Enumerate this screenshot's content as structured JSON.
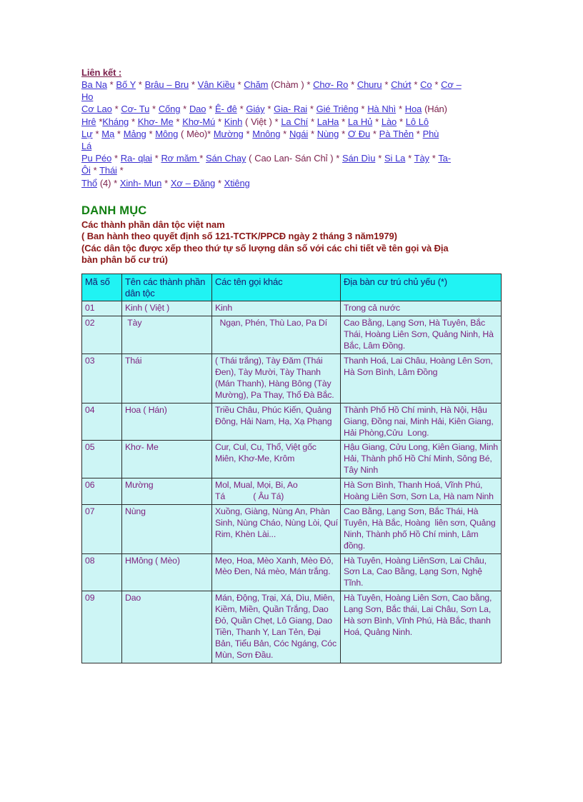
{
  "links": {
    "title": "Liên kết :",
    "lines": [
      [
        {
          "t": "Ba Na",
          "link": true
        },
        {
          "t": " * ",
          "link": false
        },
        {
          "t": "Bố Y",
          "link": true
        },
        {
          "t": " * ",
          "link": false
        },
        {
          "t": "Brâu – Bru",
          "link": true
        },
        {
          "t": " * ",
          "link": false
        },
        {
          "t": "Vân Kiều",
          "link": true
        },
        {
          "t": " * ",
          "link": false
        },
        {
          "t": "Chăm",
          "link": true
        },
        {
          "t": " (Chàm ) * ",
          "link": false
        },
        {
          "t": "Chơ- Ro",
          "link": true
        },
        {
          "t": " * ",
          "link": false
        },
        {
          "t": "Churu",
          "link": true
        },
        {
          "t": " * ",
          "link": false
        },
        {
          "t": "Chứt",
          "link": true
        },
        {
          "t": " *  ",
          "link": false
        },
        {
          "t": "Co",
          "link": true
        },
        {
          "t": " * ",
          "link": false
        },
        {
          "t": "Cơ –",
          "link": true
        }
      ],
      [
        {
          "t": "Ho",
          "link": true
        }
      ],
      [
        {
          "t": "Cơ Lao",
          "link": true
        },
        {
          "t": " * ",
          "link": false
        },
        {
          "t": "Cơ- Tu",
          "link": true
        },
        {
          "t": " * ",
          "link": false
        },
        {
          "t": "Cống",
          "link": true
        },
        {
          "t": " * ",
          "link": false
        },
        {
          "t": "Dao",
          "link": true
        },
        {
          "t": " * ",
          "link": false
        },
        {
          "t": "Ê- đê",
          "link": true
        },
        {
          "t": " *  ",
          "link": false
        },
        {
          "t": "Giáy",
          "link": true
        },
        {
          "t": " * ",
          "link": false
        },
        {
          "t": "Gia- Rai",
          "link": true
        },
        {
          "t": " * ",
          "link": false
        },
        {
          "t": "Gié Triêng",
          "link": true
        },
        {
          "t": " * ",
          "link": false
        },
        {
          "t": "Hà Nhì",
          "link": true
        },
        {
          "t": " * ",
          "link": false
        },
        {
          "t": "Hoa",
          "link": true
        },
        {
          "t": " (Hán)",
          "link": false
        }
      ],
      [
        {
          "t": "Hrê",
          "link": true
        },
        {
          "t": " *",
          "link": false
        },
        {
          "t": "Kháng",
          "link": true
        },
        {
          "t": " * ",
          "link": false
        },
        {
          "t": "Khơ- Me",
          "link": true
        },
        {
          "t": " * ",
          "link": false
        },
        {
          "t": "Khơ-Mú",
          "link": true
        },
        {
          "t": " * ",
          "link": false
        },
        {
          "t": "Kinh",
          "link": true
        },
        {
          "t": " ( Việt ) * ",
          "link": false
        },
        {
          "t": "La Chí",
          "link": true
        },
        {
          "t": " * ",
          "link": false
        },
        {
          "t": "LaHa",
          "link": true
        },
        {
          "t": " * ",
          "link": false
        },
        {
          "t": "La Hủ",
          "link": true
        },
        {
          "t": " * ",
          "link": false
        },
        {
          "t": "Lào",
          "link": true
        },
        {
          "t": " * ",
          "link": false
        },
        {
          "t": "Lô Lô",
          "link": true
        }
      ],
      [
        {
          "t": "Lự",
          "link": true
        },
        {
          "t": " * ",
          "link": false
        },
        {
          "t": "Mạ",
          "link": true
        },
        {
          "t": "  * ",
          "link": false
        },
        {
          "t": "Mảng",
          "link": true
        },
        {
          "t": " * ",
          "link": false
        },
        {
          "t": "Mông",
          "link": true
        },
        {
          "t": " ( Mèo)* ",
          "link": false
        },
        {
          "t": "Mường",
          "link": true
        },
        {
          "t": "  * ",
          "link": false
        },
        {
          "t": "Mnông",
          "link": true
        },
        {
          "t": " * ",
          "link": false
        },
        {
          "t": " Ngái",
          "link": true
        },
        {
          "t": " * ",
          "link": false
        },
        {
          "t": "Nùng",
          "link": true
        },
        {
          "t": "  * ",
          "link": false
        },
        {
          "t": "Ơ Đu",
          "link": true
        },
        {
          "t": " * ",
          "link": false
        },
        {
          "t": "Pà Thẻn",
          "link": true
        },
        {
          "t": " * ",
          "link": false
        },
        {
          "t": "Phù",
          "link": true
        }
      ],
      [
        {
          "t": "Lá",
          "link": true
        }
      ],
      [
        {
          "t": "Pu Péo",
          "link": true
        },
        {
          "t": " * ",
          "link": false
        },
        {
          "t": "Ra- qlai",
          "link": true
        },
        {
          "t": " *   ",
          "link": false
        },
        {
          "t": "Rơ măm ",
          "link": true
        },
        {
          "t": " * ",
          "link": false
        },
        {
          "t": "Sán Chay",
          "link": true
        },
        {
          "t": " ( Cao Lan- Sán Chỉ ) * ",
          "link": false
        },
        {
          "t": "Sán Dìu",
          "link": true
        },
        {
          "t": " * ",
          "link": false
        },
        {
          "t": "Si La",
          "link": true
        },
        {
          "t": " * ",
          "link": false
        },
        {
          "t": "Tày",
          "link": true
        },
        {
          "t": " * ",
          "link": false
        },
        {
          "t": "Ta-",
          "link": true
        }
      ],
      [
        {
          "t": "Ôi",
          "link": true
        },
        {
          "t": " *  ",
          "link": false
        },
        {
          "t": "Thái",
          "link": true
        },
        {
          "t": " *",
          "link": false
        }
      ],
      [
        {
          "t": "Thổ",
          "link": true
        },
        {
          "t": " (4) * ",
          "link": false
        },
        {
          "t": "Xinh- Mun",
          "link": true
        },
        {
          "t": " * ",
          "link": false
        },
        {
          "t": "Xơ – Đăng",
          "link": true
        },
        {
          "t": " * ",
          "link": false
        },
        {
          "t": "Xtiêng",
          "link": true
        }
      ]
    ]
  },
  "heading": {
    "title": "DANH MỤC",
    "subtitle1": "Các thành phần dân tộc việt nam",
    "subtitle2": "( Ban hành theo quyết định số 121-TCTK/PPCĐ   ngày 2 tháng 3 năm1979)",
    "subtitle3": "(Các dân tộc được xếp theo thứ tự số lượng  dân số với các chi tiết về tên gọi và Địa",
    "subtitle4": "bàn phân bố cư trú)"
  },
  "table": {
    "columns": [
      "Mã số",
      "Tên các thành phần dân tộc",
      "Các tên gọi khác",
      "Địa bàn cư trú chủ yếu (*)"
    ],
    "rows": [
      {
        "code": "01",
        "name": "Kinh ( Việt )",
        "other": "Kinh",
        "region": "Trong cả nước"
      },
      {
        "code": "02",
        "name": " Tày",
        "other": "  Ngạn, Phén, Thù Lao, Pa Dí",
        "region": "Cao Bằng, Lạng Sơn, Hà Tuyên, Bắc Thái, Hoàng Liên Sơn, Quảng Ninh, Hà Bắc, Lâm Đồng."
      },
      {
        "code": "03",
        "name": "Thái",
        "other": "( Thái trắng), Tày Đăm (Thái Đen), Tày Mười, Tày Thanh (Mán Thanh), Hàng Bông (Tày Mường), Pa Thay, Thổ Đà Bắc.",
        "region": "Thanh Hoá, Lai Châu, Hoàng Lên Sơn, Hà Sơn Bình, Lâm Đồng"
      },
      {
        "code": "04",
        "name": "Hoa ( Hán)",
        "other": "Triều Châu, Phúc Kiến, Quảng Đông, Hải Nam, Hạ, Xạ Phạng",
        "region": "Thành Phố Hồ Chí minh, Hà Nội, Hậu Giang, Đồng nai, Minh Hải, Kiên Giang, Hải Phòng,Cửu  Long."
      },
      {
        "code": "05",
        "name": "Khơ- Me",
        "other": "Cur, Cul, Cu, Thổ, Việt gốc Miên, Khơ-Me, Krôm",
        "region": "Hậu Giang, Cửu Long, Kiên Giang, Minh Hải, Thành phố Hồ Chí Minh, Sông Bé, Tây Ninh"
      },
      {
        "code": "06",
        "name": "Mường",
        "other": "Mol, Mual, Mọi, Bi, Ao\nTá            ( Âu Tá)",
        "region": "Hà Sơn Bình, Thanh Hoá, Vĩnh Phú, Hoàng Liên Sơn, Sơn La, Hà nam Ninh"
      },
      {
        "code": "07",
        "name": "Nùng",
        "other": "Xuồng, Giàng, Nùng An, Phàn Sinh, Nùng Cháo, Nùng Lòi, Quí Rim, Khèn Lài...",
        "region": "Cao Bằng, Lạng Sơn, Bắc Thái, Hà Tuyên, Hà Bắc, Hoàng  liên sơn, Quảng Ninh, Thành phố Hồ Chí minh, Lâm đồng."
      },
      {
        "code": "08",
        "name": "HMông ( Mèo)",
        "other": "Mẹo, Hoa, Mèo Xanh, Mèo Đỏ, Mèo Đen, Ná mèo, Mán trắng.",
        "region": "Hà Tuyên, Hoàng LiênSơn, Lai Châu, Sơn La, Cao Bằng, Lạng Sơn, Nghệ Tĩnh."
      },
      {
        "code": "09",
        "name": "Dao",
        "other": "Mán, Động, Trại, Xá, Dìu, Miên, Kiềm, Miền, Quần Trắng, Dao Đỏ, Quần Chẹt, Lô Giang, Dao Tiền, Thanh Y, Lan Tẻn, Đại Bản, Tiểu Bản, Cóc Ngáng, Cóc Mùn, Sơn Đầu.",
        "region": "Hà Tuyên, Hoàng Liên Sơn, Cao bằng, Lạng Sơn, Bắc thái, Lai Châu, Sơn La, Hà sơn Bình, Vĩnh Phú, Hà Bắc, thanh Hoá, Quảng Ninh."
      }
    ]
  },
  "colors": {
    "link": "#3a2fd0",
    "plain_text": "#7b1f4b",
    "heading_green": "#128012",
    "subtitle_red": "#8a1616",
    "table_header_bg": "#20f3f3",
    "table_header_text": "#16166e",
    "table_body_bg": "#cdf5f5",
    "table_body_text": "#7d1f7d"
  }
}
